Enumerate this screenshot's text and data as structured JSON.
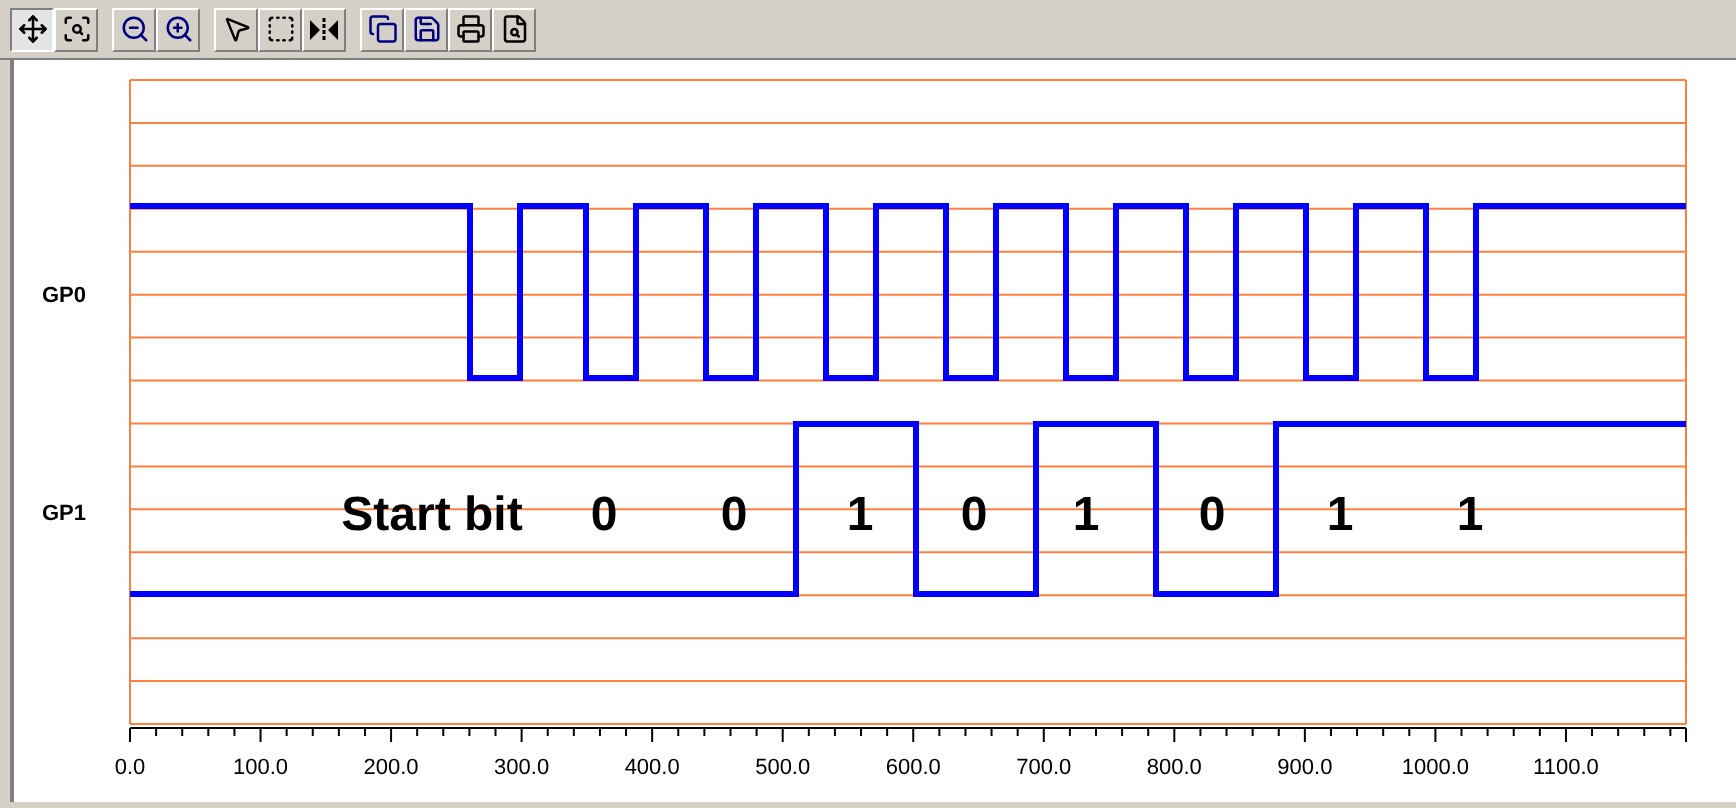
{
  "toolbar": {
    "groups": [
      [
        {
          "kind": "pan",
          "selected": true
        },
        {
          "kind": "zoomarea",
          "selected": false
        }
      ],
      [
        {
          "kind": "zoomout",
          "selected": false
        },
        {
          "kind": "zoomin",
          "selected": false
        }
      ],
      [
        {
          "kind": "pointer",
          "selected": false
        },
        {
          "kind": "select",
          "selected": false
        },
        {
          "kind": "fit",
          "selected": false
        }
      ],
      [
        {
          "kind": "copy",
          "selected": false
        },
        {
          "kind": "save",
          "selected": false
        },
        {
          "kind": "print",
          "selected": false
        },
        {
          "kind": "preview",
          "selected": false
        }
      ]
    ]
  },
  "channels": [
    {
      "label": "GP0"
    },
    {
      "label": "GP1"
    }
  ],
  "bit_labels": [
    "Start bit",
    "0",
    "0",
    "1",
    "0",
    "1",
    "0",
    "1",
    "1"
  ],
  "x_axis": {
    "labels": [
      "0.0",
      "100.0",
      "200.0",
      "300.0",
      "400.0",
      "500.0",
      "600.0",
      "700.0",
      "800.0",
      "900.0",
      "1000.0",
      "1100.0"
    ]
  }
}
